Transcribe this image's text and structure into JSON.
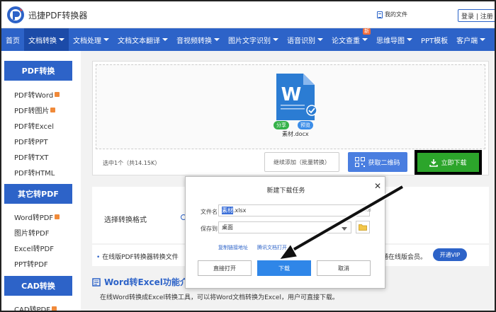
{
  "header": {
    "brand": "迅捷PDF转换器",
    "my_files": "我的文件",
    "auth": "登录 | 注册"
  },
  "nav": {
    "items": [
      {
        "label": "首页",
        "caret": false
      },
      {
        "label": "文档转换",
        "caret": true
      },
      {
        "label": "文档处理",
        "caret": true
      },
      {
        "label": "文档文本翻译",
        "caret": true
      },
      {
        "label": "音视频转换",
        "caret": true
      },
      {
        "label": "图片文字识别",
        "caret": true
      },
      {
        "label": "语音识别",
        "caret": true
      },
      {
        "label": "论文查重",
        "caret": true
      },
      {
        "label": "思维导图",
        "caret": true
      },
      {
        "label": "PPT模板",
        "caret": false
      },
      {
        "label": "客户端",
        "caret": true
      }
    ],
    "new_badge": "新"
  },
  "sidebar": {
    "pdf_head": "PDF转换",
    "pdf_items": [
      "PDF转Word",
      "PDF转图片",
      "PDF转Excel",
      "PDF转PPT",
      "PDF转TXT",
      "PDF转HTML"
    ],
    "other_head": "其它转PDF",
    "other_items": [
      "Word转PDF",
      "图片转PDF",
      "Excel转PDF",
      "PPT转PDF"
    ],
    "cad_head": "CAD转换",
    "cad_items": [
      "CAD转PDF"
    ]
  },
  "converter": {
    "file_icon_letter": "W",
    "tag_share": "分享",
    "tag_preview": "预览",
    "file_name": "素材.docx",
    "selected_info": "选中1个（共14.15K）",
    "add_button": "继续添加（批量转换）",
    "qr_button": "获取二维码",
    "download_button": "立即下载"
  },
  "format": {
    "label": "选择转换格式"
  },
  "info": {
    "text": "在线版PDF转换器转换文件",
    "text_right": "通在线版会员。",
    "vip_button": "开通VIP"
  },
  "intro": {
    "title": "Word转Excel功能介绍",
    "text": "在线Word转换成Excel转换工具，可以将Word文档转换为Excel，用户可直接下载。"
  },
  "modal": {
    "title": "新建下载任务",
    "filename_label": "文件名",
    "filename_selected": "素材",
    "filename_rest": ".xlsx",
    "size": "5KB",
    "save_to_label": "保存到",
    "save_to_value": "桌面",
    "copy_link": "复制链接地址",
    "tencent_open": "腾讯文档打开",
    "open_button": "直接打开",
    "download_button": "下载",
    "cancel_button": "取消"
  },
  "colors": {
    "nav_blue": "#2d63c8",
    "download_green": "#2ca52b",
    "word_blue": "#2b7cd3"
  }
}
